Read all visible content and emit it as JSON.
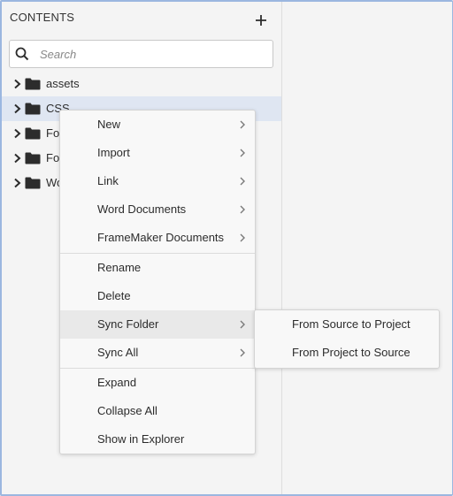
{
  "panel": {
    "title": "CONTENTS"
  },
  "search": {
    "placeholder": "Search",
    "value": ""
  },
  "tree": [
    {
      "label": "assets",
      "selected": false
    },
    {
      "label": "CSS",
      "selected": true
    },
    {
      "label": "Fo",
      "selected": false
    },
    {
      "label": "Fo",
      "selected": false
    },
    {
      "label": "Wo",
      "selected": false
    }
  ],
  "context_menu": {
    "groups": [
      [
        {
          "label": "New",
          "submenu": true
        },
        {
          "label": "Import",
          "submenu": true
        },
        {
          "label": "Link",
          "submenu": true
        },
        {
          "label": "Word Documents",
          "submenu": true
        },
        {
          "label": "FrameMaker Documents",
          "submenu": true
        }
      ],
      [
        {
          "label": "Rename",
          "submenu": false
        },
        {
          "label": "Delete",
          "submenu": false
        },
        {
          "label": "Sync Folder",
          "submenu": true,
          "highlighted": true
        },
        {
          "label": "Sync All",
          "submenu": true
        }
      ],
      [
        {
          "label": "Expand",
          "submenu": false
        },
        {
          "label": "Collapse All",
          "submenu": false
        },
        {
          "label": "Show in Explorer",
          "submenu": false
        }
      ]
    ]
  },
  "submenu": {
    "items": [
      {
        "label": "From Source to Project"
      },
      {
        "label": "From Project to Source"
      }
    ]
  },
  "colors": {
    "selection": "#dfe6f2",
    "frame_border": "#9bb7e0",
    "menu_bg": "#f8f8f8",
    "highlight": "#e9e9e9"
  },
  "icons": {
    "add": "plus-icon",
    "search": "search-icon",
    "expand": "chevron-right-icon",
    "folder": "folder-icon",
    "submenu": "submenu-arrow-icon"
  }
}
